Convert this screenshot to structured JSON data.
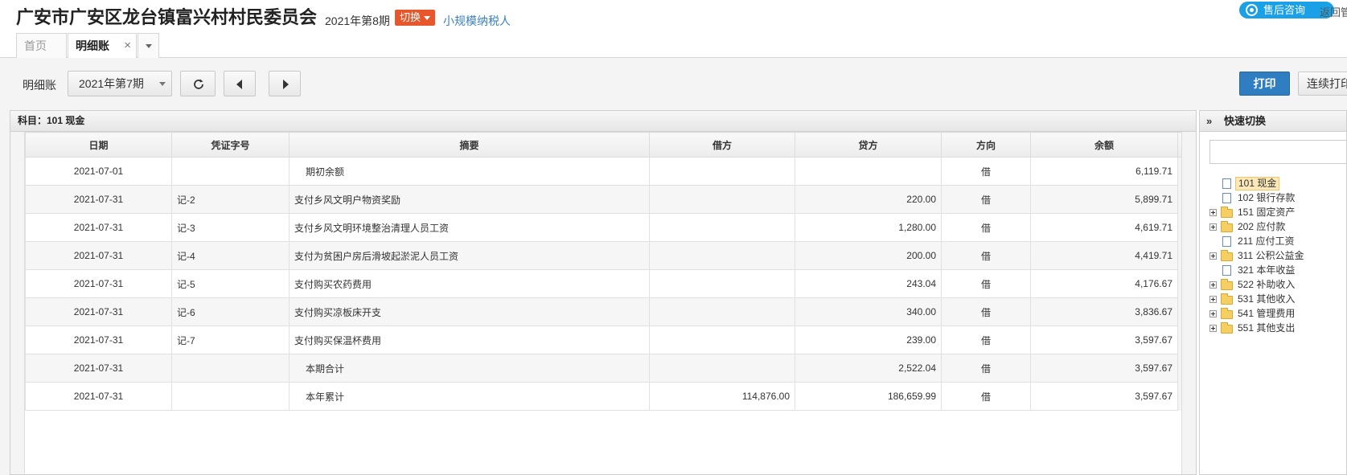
{
  "header": {
    "org_title": "广安市广安区龙台镇富兴村村民委员会",
    "period_label": "2021年第8期",
    "switch_label": "切换",
    "taxpayer_label": "小规模纳税人",
    "support_label": "售后咨询",
    "back_label": "返回管"
  },
  "tabs": [
    {
      "label": "首页"
    },
    {
      "label": "明细账",
      "close": "×"
    }
  ],
  "toolbar": {
    "label": "明细账",
    "period_select": "2021年第7期",
    "print_label": "打印",
    "print_continuous_label": "连续打印"
  },
  "main": {
    "subject": "科目：101  现金",
    "columns": [
      "日期",
      "凭证字号",
      "摘要",
      "借方",
      "贷方",
      "方向",
      "余额"
    ],
    "rows": [
      {
        "date": "2021-07-01",
        "voucher": "",
        "summary": "期初余额",
        "debit": "",
        "credit": "",
        "dir": "借",
        "balance": "6,119.71",
        "indent": true
      },
      {
        "date": "2021-07-31",
        "voucher": "记-2",
        "summary": "支付乡风文明户物资奖励",
        "debit": "",
        "credit": "220.00",
        "dir": "借",
        "balance": "5,899.71",
        "indent": false
      },
      {
        "date": "2021-07-31",
        "voucher": "记-3",
        "summary": "支付乡风文明环境整治清理人员工资",
        "debit": "",
        "credit": "1,280.00",
        "dir": "借",
        "balance": "4,619.71",
        "indent": false
      },
      {
        "date": "2021-07-31",
        "voucher": "记-4",
        "summary": "支付为贫困户房后滑坡起淤泥人员工资",
        "debit": "",
        "credit": "200.00",
        "dir": "借",
        "balance": "4,419.71",
        "indent": false
      },
      {
        "date": "2021-07-31",
        "voucher": "记-5",
        "summary": "支付购买农药费用",
        "debit": "",
        "credit": "243.04",
        "dir": "借",
        "balance": "4,176.67",
        "indent": false
      },
      {
        "date": "2021-07-31",
        "voucher": "记-6",
        "summary": "支付购买凉板床开支",
        "debit": "",
        "credit": "340.00",
        "dir": "借",
        "balance": "3,836.67",
        "indent": false
      },
      {
        "date": "2021-07-31",
        "voucher": "记-7",
        "summary": "支付购买保温杯费用",
        "debit": "",
        "credit": "239.00",
        "dir": "借",
        "balance": "3,597.67",
        "indent": false
      },
      {
        "date": "2021-07-31",
        "voucher": "",
        "summary": "本期合计",
        "debit": "",
        "credit": "2,522.04",
        "dir": "借",
        "balance": "3,597.67",
        "indent": true
      },
      {
        "date": "2021-07-31",
        "voucher": "",
        "summary": "本年累计",
        "debit": "114,876.00",
        "credit": "186,659.99",
        "dir": "借",
        "balance": "3,597.67",
        "indent": true
      }
    ]
  },
  "side_panel": {
    "chevron": "»",
    "title": "快速切换",
    "tree": [
      {
        "label": "101 现金",
        "type": "file",
        "expandable": false,
        "selected": true
      },
      {
        "label": "102 银行存款",
        "type": "file",
        "expandable": false,
        "selected": false
      },
      {
        "label": "151 固定资产",
        "type": "folder",
        "expandable": true,
        "selected": false
      },
      {
        "label": "202 应付款",
        "type": "folder",
        "expandable": true,
        "selected": false
      },
      {
        "label": "211 应付工资",
        "type": "file",
        "expandable": false,
        "selected": false
      },
      {
        "label": "311 公积公益金",
        "type": "folder",
        "expandable": true,
        "selected": false
      },
      {
        "label": "321 本年收益",
        "type": "file",
        "expandable": false,
        "selected": false
      },
      {
        "label": "522 补助收入",
        "type": "folder",
        "expandable": true,
        "selected": false
      },
      {
        "label": "531 其他收入",
        "type": "folder",
        "expandable": true,
        "selected": false
      },
      {
        "label": "541 管理费用",
        "type": "folder",
        "expandable": true,
        "selected": false
      },
      {
        "label": "551 其他支出",
        "type": "folder",
        "expandable": true,
        "selected": false
      }
    ]
  }
}
